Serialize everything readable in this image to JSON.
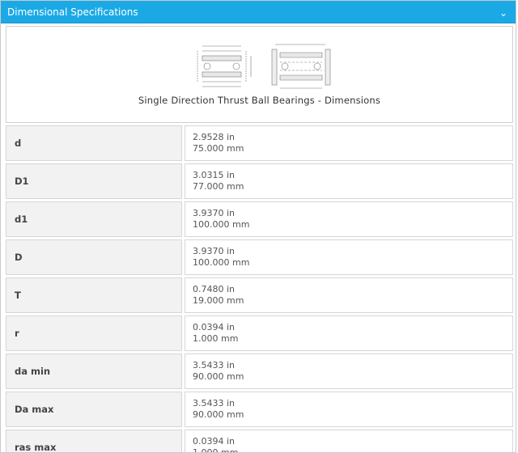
{
  "header": {
    "title": "Dimensional Specifications",
    "icon": "chevron-down-icon"
  },
  "diagram": {
    "caption": "Single Direction Thrust Ball Bearings - Dimensions"
  },
  "specs": [
    {
      "label": "d",
      "inch": "2.9528 in",
      "mm": "75.000 mm"
    },
    {
      "label": "D1",
      "inch": "3.0315 in",
      "mm": "77.000 mm"
    },
    {
      "label": "d1",
      "inch": "3.9370 in",
      "mm": "100.000 mm"
    },
    {
      "label": "D",
      "inch": "3.9370 in",
      "mm": "100.000 mm"
    },
    {
      "label": "T",
      "inch": "0.7480 in",
      "mm": "19.000 mm"
    },
    {
      "label": "r",
      "inch": "0.0394 in",
      "mm": "1.000 mm"
    },
    {
      "label": "da min",
      "inch": "3.5433 in",
      "mm": "90.000 mm"
    },
    {
      "label": "Da max",
      "inch": "3.5433 in",
      "mm": "90.000 mm"
    },
    {
      "label": "ras max",
      "inch": "0.0394 in",
      "mm": "1.000 mm"
    }
  ],
  "colors": {
    "header_bg": "#1ba9e6",
    "label_bg": "#f2f2f2",
    "border": "#d6d6d6"
  }
}
